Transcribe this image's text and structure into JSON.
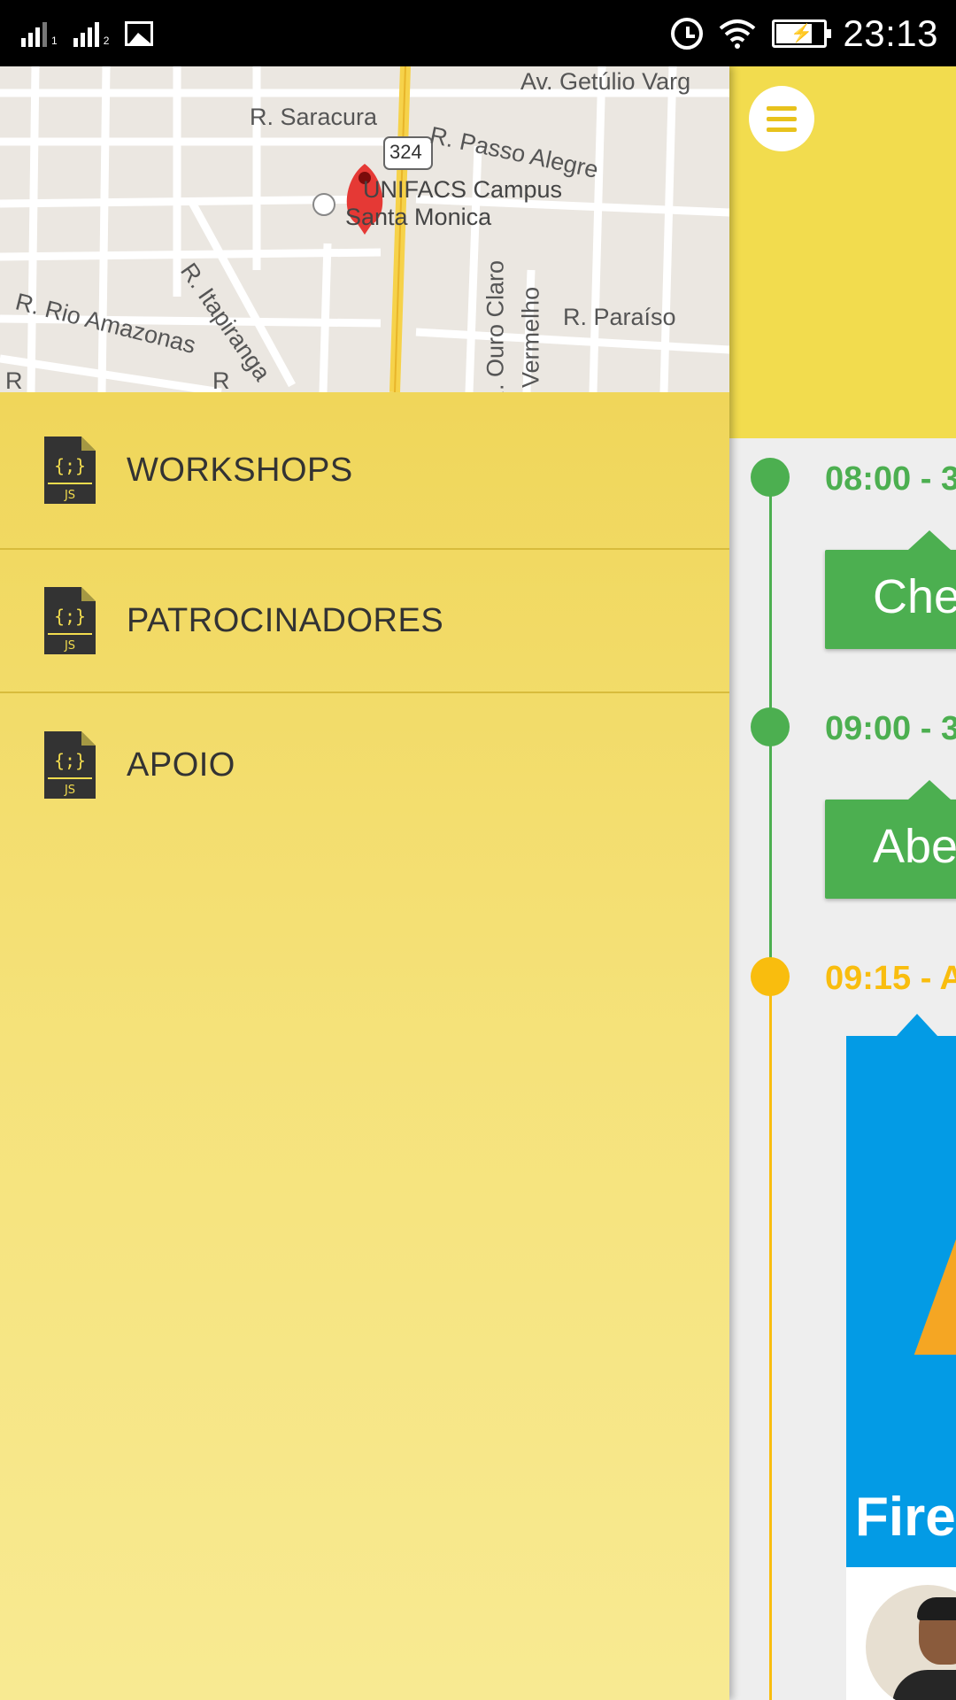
{
  "status_bar": {
    "time": "23:13",
    "sim1": "1",
    "sim2": "2"
  },
  "map": {
    "labels": {
      "av_getulio": "Av. Getúlio Varg",
      "saracura": "R. Saracura",
      "passo_alegre": "R. Passo Alegre",
      "route": "324",
      "campus_line1": "UNIFACS Campus",
      "campus_line2": "Santa Monica",
      "itapiranga": "R. Itapiranga",
      "rio_amazonas": "R. Rio Amazonas",
      "ouro_claro": "R. Ouro Claro",
      "vermelho": "o Vermelho",
      "paraiso": "R. Paraíso",
      "edge_r1": "R",
      "edge_r2": "R"
    }
  },
  "drawer": {
    "items": [
      {
        "label": "WORKSHOPS",
        "icon": "js-file-icon"
      },
      {
        "label": "PATROCINADORES",
        "icon": "js-file-icon"
      },
      {
        "label": "APOIO",
        "icon": "js-file-icon"
      }
    ],
    "icon_text": {
      "braces": "{;}",
      "js": "JS"
    }
  },
  "timeline": {
    "colors": {
      "done": "#4caf50",
      "current": "#f9bd0e",
      "header": "#f2dc4e",
      "feature": "#039be5"
    },
    "events": [
      {
        "time": "08:00 - 3",
        "card": "Che"
      },
      {
        "time": "09:00 - 3",
        "card": "Abe"
      },
      {
        "time": "09:15 - A",
        "card": "Firel"
      }
    ]
  }
}
